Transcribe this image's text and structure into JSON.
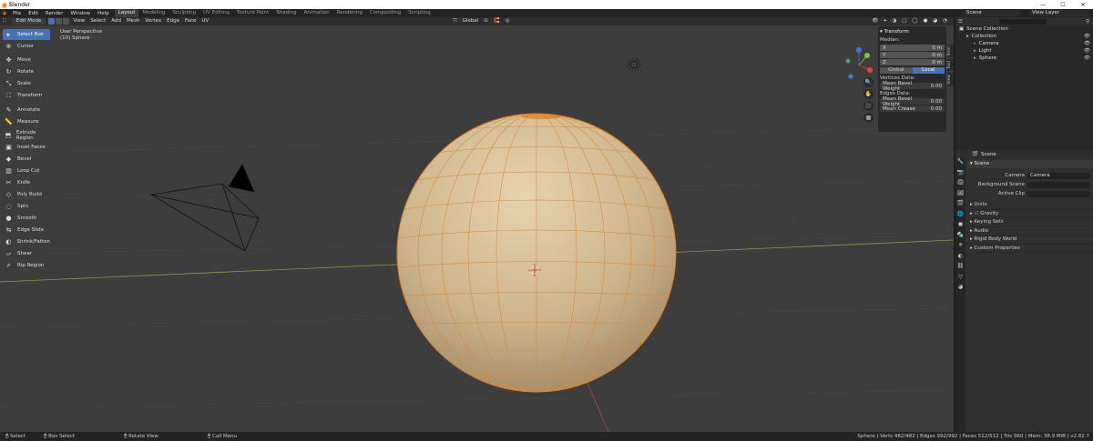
{
  "titlebar": {
    "title": "Blender",
    "controls": [
      "—",
      "☐",
      "✕"
    ]
  },
  "menu": [
    "File",
    "Edit",
    "Render",
    "Window",
    "Help"
  ],
  "workspaces": [
    "Layout",
    "Modeling",
    "Sculpting",
    "UV Editing",
    "Texture Paint",
    "Shading",
    "Animation",
    "Rendering",
    "Compositing",
    "Scripting"
  ],
  "active_workspace": "Layout",
  "scene_selector": "Scene",
  "view_layer": "View Layer",
  "viewport": {
    "mode": "Edit Mode",
    "menus": [
      "View",
      "Select",
      "Add",
      "Mesh",
      "Vertex",
      "Edge",
      "Face",
      "UV"
    ],
    "orientation": "Global",
    "perspective": "User Perspective",
    "object_label": "(10) Sphere"
  },
  "tools": [
    {
      "label": "Select Box",
      "icon": "▸"
    },
    {
      "label": "Cursor",
      "icon": "⊕"
    },
    {
      "label": "Move",
      "icon": "✥"
    },
    {
      "label": "Rotate",
      "icon": "↻"
    },
    {
      "label": "Scale",
      "icon": "⤡"
    },
    {
      "label": "Transform",
      "icon": "⛶"
    },
    {
      "label": "Annotate",
      "icon": "✎"
    },
    {
      "label": "Measure",
      "icon": "📏"
    },
    {
      "label": "Extrude Region",
      "icon": "⬒"
    },
    {
      "label": "Inset Faces",
      "icon": "▣"
    },
    {
      "label": "Bevel",
      "icon": "◆"
    },
    {
      "label": "Loop Cut",
      "icon": "▥"
    },
    {
      "label": "Knife",
      "icon": "✂"
    },
    {
      "label": "Poly Build",
      "icon": "◇"
    },
    {
      "label": "Spin",
      "icon": "◌"
    },
    {
      "label": "Smooth",
      "icon": "●"
    },
    {
      "label": "Edge Slide",
      "icon": "⇆"
    },
    {
      "label": "Shrink/Fatten",
      "icon": "◐"
    },
    {
      "label": "Shear",
      "icon": "▱"
    },
    {
      "label": "Rip Region",
      "icon": "⌿"
    }
  ],
  "npanel": {
    "title": "Transform",
    "median_label": "Median:",
    "median": [
      {
        "axis": "X",
        "value": "0 m"
      },
      {
        "axis": "Y",
        "value": "0 m"
      },
      {
        "axis": "Z",
        "value": "0 m"
      }
    ],
    "space": [
      "Global",
      "Local"
    ],
    "space_active": "Local",
    "vertices_label": "Vertices Data:",
    "vertex_bevel": {
      "label": "Mean Bevel Weight",
      "value": "0.00"
    },
    "edges_label": "Edges Data:",
    "edge_bevel": {
      "label": "Mean Bevel Weight",
      "value": "0.00"
    },
    "crease": {
      "label": "Mean Crease",
      "value": "0.00"
    },
    "tabs": [
      "Item",
      "Tool",
      "View"
    ]
  },
  "outliner": {
    "root": "Scene Collection",
    "rows": [
      {
        "label": "Collection",
        "color": "#bbbbbb",
        "depth": 1
      },
      {
        "label": "Camera",
        "color": "#9b6b3c",
        "depth": 2
      },
      {
        "label": "Light",
        "color": "#c7923b",
        "depth": 2
      },
      {
        "label": "Sphere",
        "color": "#e8a040",
        "depth": 2
      }
    ]
  },
  "properties": {
    "header": "Scene",
    "section": "Scene",
    "camera_label": "Camera",
    "camera_value": "Camera",
    "background_label": "Background Scene",
    "active_clip_label": "Active Clip",
    "subsections": [
      "Units",
      "Gravity",
      "Keying Sets",
      "Audio",
      "Rigid Body World",
      "Custom Properties"
    ]
  },
  "status": {
    "items": [
      "Select",
      "Box Select",
      "Rotate View",
      "Call Menu"
    ],
    "stats": "Sphere | Verts 482/482 | Edges 992/992 | Faces 512/512 | Tris 960 | Mem: 38.9 MiB | v2.82.7"
  }
}
